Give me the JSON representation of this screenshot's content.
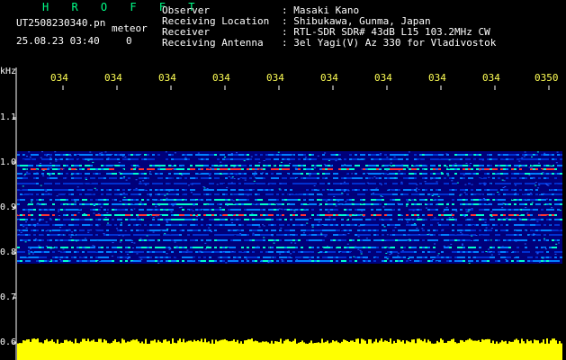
{
  "header": {
    "brand": "H R O F F T",
    "filename": "UT2508230340.pn",
    "meteor_label": "meteor",
    "datetime": "25.08.23 03:40",
    "count": "0"
  },
  "station_info": [
    {
      "label": "Observer",
      "value": ": Masaki Kano"
    },
    {
      "label": "Receiving Location",
      "value": ": Shibukawa, Gunma, Japan"
    },
    {
      "label": "Receiver",
      "value": ": RTL-SDR SDR# 43dB L15 103.2MHz CW"
    },
    {
      "label": "Receiving Antenna",
      "value": ": 3el Yagi(V) Az 330 for Vladivostok"
    }
  ],
  "y_axis": {
    "unit": "kHz",
    "ticks": [
      "1.1",
      "1.0",
      "0.9",
      "0.8",
      "0.7",
      "0.6"
    ]
  },
  "time_axis": {
    "ticks": [
      "034",
      "034",
      "034",
      "034",
      "034",
      "034",
      "034",
      "034",
      "034",
      "0350"
    ]
  },
  "colors": {
    "background": "#000000",
    "header_brand": "#00ff88",
    "time_ticks": "#ffff55",
    "noise_floor": "#ffff00",
    "waterfall_low": "#0000aa",
    "waterfall_mid": "#00ffcc",
    "waterfall_high": "#ff3333"
  }
}
